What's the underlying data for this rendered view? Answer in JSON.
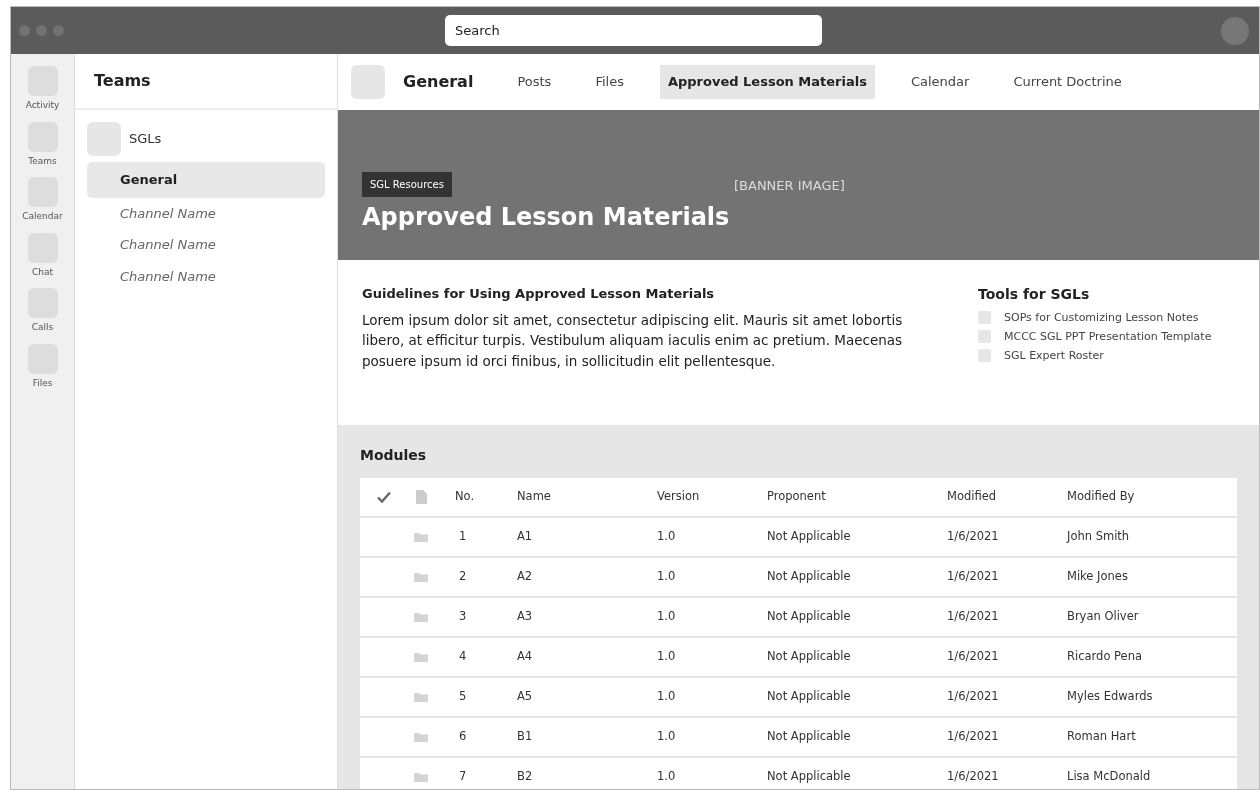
{
  "search": {
    "placeholder": "Search"
  },
  "rail": [
    {
      "label": "Activity"
    },
    {
      "label": "Teams"
    },
    {
      "label": "Calendar"
    },
    {
      "label": "Chat"
    },
    {
      "label": "Calls"
    },
    {
      "label": "Files"
    }
  ],
  "teams_panel": {
    "title": "Teams",
    "team": "SGLs",
    "channels": [
      {
        "label": "General",
        "selected": true
      },
      {
        "label": "Channel Name",
        "selected": false
      },
      {
        "label": "Channel Name",
        "selected": false
      },
      {
        "label": "Channel Name",
        "selected": false
      }
    ]
  },
  "channel_header": {
    "title": "General",
    "tabs": [
      {
        "label": "Posts",
        "selected": false
      },
      {
        "label": "Files",
        "selected": false
      },
      {
        "label": "Approved Lesson Materials",
        "selected": true
      },
      {
        "label": "Calendar",
        "selected": false
      },
      {
        "label": "Current Doctrine",
        "selected": false
      }
    ]
  },
  "banner": {
    "tag": "SGL Resources",
    "placeholder_text": "[BANNER IMAGE]",
    "title": "Approved Lesson Materials"
  },
  "guidelines": {
    "title": "Guidelines for Using Approved Lesson Materials",
    "text": "Lorem ipsum dolor sit amet, consectetur adipiscing elit. Mauris sit amet lobortis libero, at efficitur turpis. Vestibulum aliquam iaculis enim ac pretium. Maecenas posuere ipsum id orci finibus, in sollicitudin elit pellentesque."
  },
  "tools": {
    "title": "Tools for SGLs",
    "items": [
      {
        "label": "SOPs for Customizing Lesson Notes"
      },
      {
        "label": "MCCC SGL PPT Presentation Template"
      },
      {
        "label": "SGL Expert Roster"
      }
    ]
  },
  "modules": {
    "title": "Modules",
    "columns": [
      "No.",
      "Name",
      "Version",
      "Proponent",
      "Modified",
      "Modified By"
    ],
    "rows": [
      [
        "1",
        "A1",
        "1.0",
        "Not Applicable",
        "1/6/2021",
        "John Smith"
      ],
      [
        "2",
        "A2",
        "1.0",
        "Not Applicable",
        "1/6/2021",
        "Mike Jones"
      ],
      [
        "3",
        "A3",
        "1.0",
        "Not Applicable",
        "1/6/2021",
        "Bryan Oliver"
      ],
      [
        "4",
        "A4",
        "1.0",
        "Not Applicable",
        "1/6/2021",
        "Ricardo Pena"
      ],
      [
        "5",
        "A5",
        "1.0",
        "Not Applicable",
        "1/6/2021",
        "Myles Edwards"
      ],
      [
        "6",
        "B1",
        "1.0",
        "Not Applicable",
        "1/6/2021",
        "Roman Hart"
      ],
      [
        "7",
        "B2",
        "1.0",
        "Not Applicable",
        "1/6/2021",
        "Lisa McDonald"
      ]
    ]
  }
}
